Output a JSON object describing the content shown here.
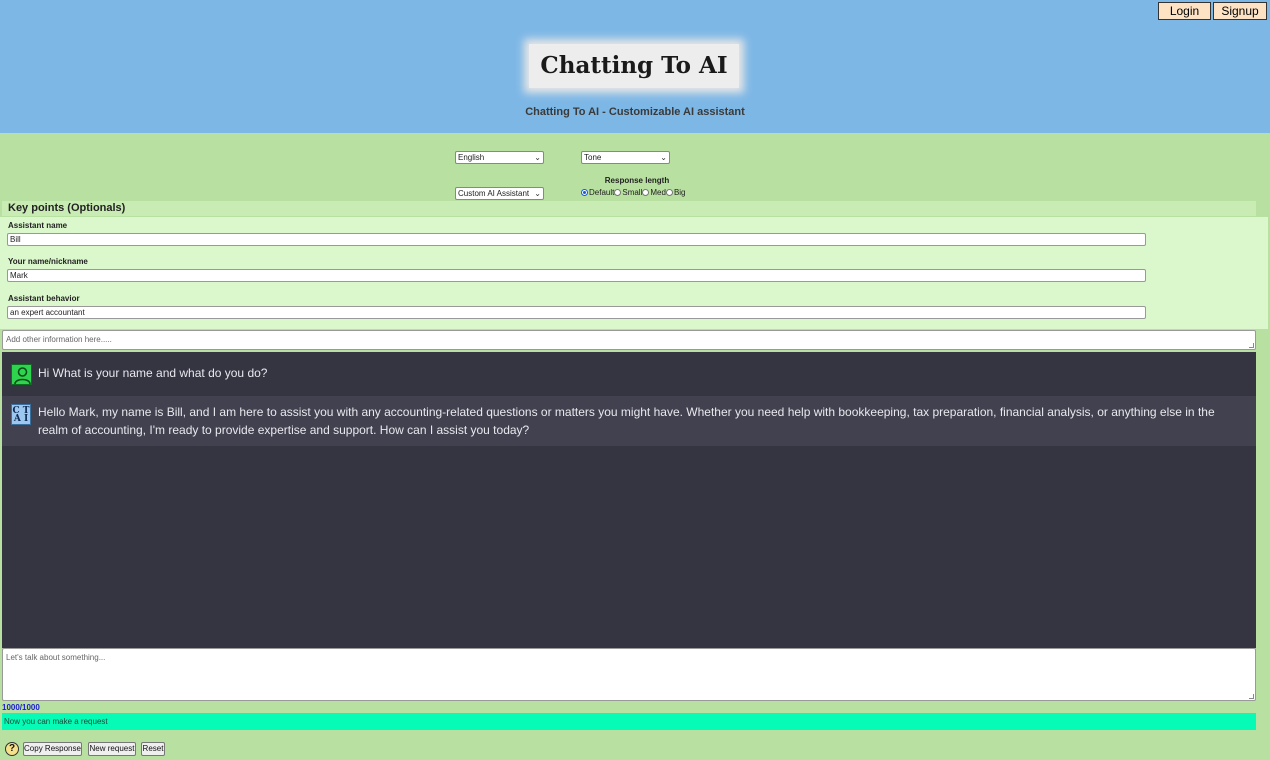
{
  "header": {
    "login_label": "Login",
    "signup_label": "Signup",
    "logo_text": "Chatting To AI",
    "subtitle": "Chatting To AI - Customizable AI assistant"
  },
  "controls": {
    "language_selected": "English",
    "tone_selected": "Tone",
    "assistant_selected": "Custom AI Assistant",
    "response_length_label": "Response length",
    "response_length_options": [
      "Default",
      "Small",
      "Med",
      "Big"
    ],
    "response_length_selected": "Default"
  },
  "key_points": {
    "title": "Key points (Optionals)",
    "assistant_name_label": "Assistant name",
    "assistant_name_value": "Bill",
    "your_name_label": "Your name/nickname",
    "your_name_value": "Mark",
    "assistant_behavior_label": "Assistant behavior",
    "assistant_behavior_value": "an expert accountant",
    "other_info_placeholder": "Add other information here....."
  },
  "chat": {
    "messages": [
      {
        "role": "user",
        "avatar_icon": "user-icon",
        "text": "Hi What is your name and what do you do?"
      },
      {
        "role": "ai",
        "avatar_icon": "ai-logo-icon",
        "avatar_text": "CT AI",
        "text": "Hello Mark, my name is Bill, and I am here to assist you with any accounting-related questions or matters you might have. Whether you need help with bookkeeping, tax preparation, financial analysis, or anything else in the realm of accounting, I'm ready to provide expertise and support. How can I assist you today?"
      }
    ],
    "input_placeholder": "Let's talk about something...",
    "char_counter": "1000/1000",
    "status_text": "Now you can make a request"
  },
  "footer": {
    "help_label": "?",
    "copy_label": "Copy Response",
    "new_label": "New request",
    "reset_label": "Reset"
  },
  "colors": {
    "header_bg": "#7db7e6",
    "page_bg": "#b8e0a0",
    "chat_bg": "#353441",
    "status_bg": "#05fbb6"
  }
}
